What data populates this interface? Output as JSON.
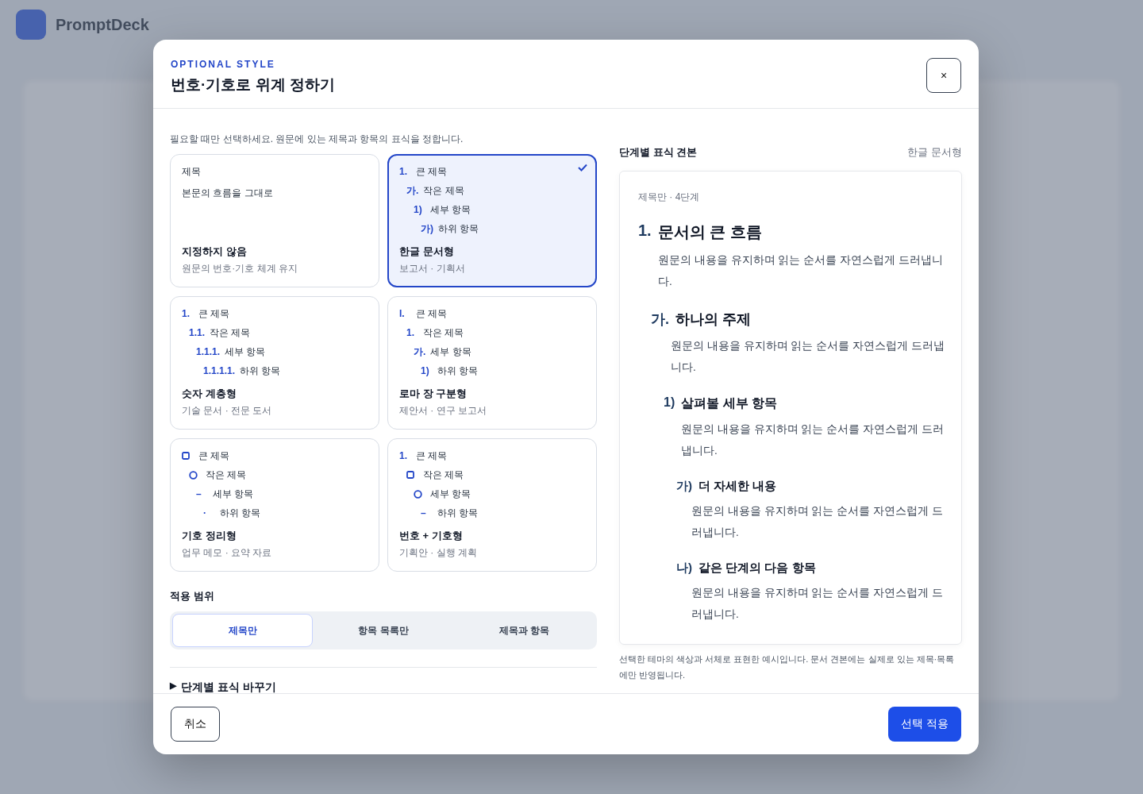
{
  "app": {
    "title": "PromptDeck"
  },
  "dialog": {
    "eyebrow": "OPTIONAL STYLE",
    "title": "번호·기호로 위계 정하기",
    "close": "×",
    "intro": "필요할 때만 선택하세요. 원문에 있는 제목과 항목의 표식을 정합니다.",
    "options": [
      {
        "kind": "plain",
        "selected": false,
        "lines": [
          "제목",
          "본문의 흐름을 그대로"
        ],
        "name": "지정하지 않음",
        "use": "원문의 번호·기호 체계 유지"
      },
      {
        "kind": "levels",
        "selected": true,
        "levels": [
          {
            "kind": "text",
            "marker": "1.",
            "label": "큰 제목"
          },
          {
            "kind": "text",
            "marker": "가.",
            "label": "작은 제목"
          },
          {
            "kind": "text",
            "marker": "1)",
            "label": "세부 항목"
          },
          {
            "kind": "text",
            "marker": "가)",
            "label": "하위 항목"
          }
        ],
        "name": "한글 문서형",
        "use": "보고서 · 기획서"
      },
      {
        "kind": "levels",
        "selected": false,
        "levels": [
          {
            "kind": "text",
            "marker": "1.",
            "label": "큰 제목"
          },
          {
            "kind": "text",
            "marker": "1.1.",
            "label": "작은 제목"
          },
          {
            "kind": "text",
            "marker": "1.1.1.",
            "label": "세부 항목"
          },
          {
            "kind": "text",
            "marker": "1.1.1.1.",
            "label": "하위 항목"
          }
        ],
        "name": "숫자 계층형",
        "use": "기술 문서 · 전문 도서"
      },
      {
        "kind": "levels",
        "selected": false,
        "levels": [
          {
            "kind": "text",
            "marker": "I.",
            "label": "큰 제목"
          },
          {
            "kind": "text",
            "marker": "1.",
            "label": "작은 제목"
          },
          {
            "kind": "text",
            "marker": "가.",
            "label": "세부 항목"
          },
          {
            "kind": "text",
            "marker": "1)",
            "label": "하위 항목"
          }
        ],
        "name": "로마 장 구분형",
        "use": "제안서 · 연구 보고서"
      },
      {
        "kind": "levels",
        "selected": false,
        "levels": [
          {
            "kind": "square",
            "label": "큰 제목"
          },
          {
            "kind": "circle",
            "label": "작은 제목"
          },
          {
            "kind": "text",
            "marker": "–",
            "label": "세부 항목"
          },
          {
            "kind": "text",
            "marker": "·",
            "label": "하위 항목"
          }
        ],
        "name": "기호 정리형",
        "use": "업무 메모 · 요약 자료"
      },
      {
        "kind": "levels",
        "selected": false,
        "levels": [
          {
            "kind": "text",
            "marker": "1.",
            "label": "큰 제목"
          },
          {
            "kind": "square",
            "label": "작은 제목"
          },
          {
            "kind": "circle",
            "label": "세부 항목"
          },
          {
            "kind": "text",
            "marker": "–",
            "label": "하위 항목"
          }
        ],
        "name": "번호 + 기호형",
        "use": "기획안 · 실행 계획"
      }
    ],
    "scope": {
      "label": "적용 범위",
      "tabs": [
        {
          "label": "제목만",
          "selected": true
        },
        {
          "label": "항목 목록만",
          "selected": false
        },
        {
          "label": "제목과 항목",
          "selected": false
        }
      ]
    },
    "disclosure": {
      "marker": "▶",
      "label": "단계별 표식 바꾸기",
      "expanded": false
    },
    "preview": {
      "title": "단계별 표식 견본",
      "style": "한글 문서형",
      "meta": "제목만 · 4단계",
      "sections": [
        {
          "marker": "1.",
          "heading": "문서의 큰 흐름",
          "body": "원문의 내용을 유지하며 읽는 순서를 자연스럽게 드러냅니다.",
          "children": [
            {
              "marker": "가.",
              "heading": "하나의 주제",
              "body": "원문의 내용을 유지하며 읽는 순서를 자연스럽게 드러냅니다.",
              "children": [
                {
                  "marker": "1)",
                  "heading": "살펴볼 세부 항목",
                  "body": "원문의 내용을 유지하며 읽는 순서를 자연스럽게 드러냅니다.",
                  "children": [
                    {
                      "marker": "가)",
                      "heading": "더 자세한 내용",
                      "body": "원문의 내용을 유지하며 읽는 순서를 자연스럽게 드러냅니다."
                    },
                    {
                      "marker": "나)",
                      "heading": "같은 단계의 다음 항목",
                      "body": "원문의 내용을 유지하며 읽는 순서를 자연스럽게 드러냅니다."
                    }
                  ]
                }
              ]
            }
          ]
        }
      ],
      "note": "선택한 테마의 색상과 서체로 표현한 예시입니다. 문서 견본에는 실제로 있는 제목·목록에만 반영됩니다."
    },
    "cancel": "취소",
    "apply": "선택 적용"
  }
}
